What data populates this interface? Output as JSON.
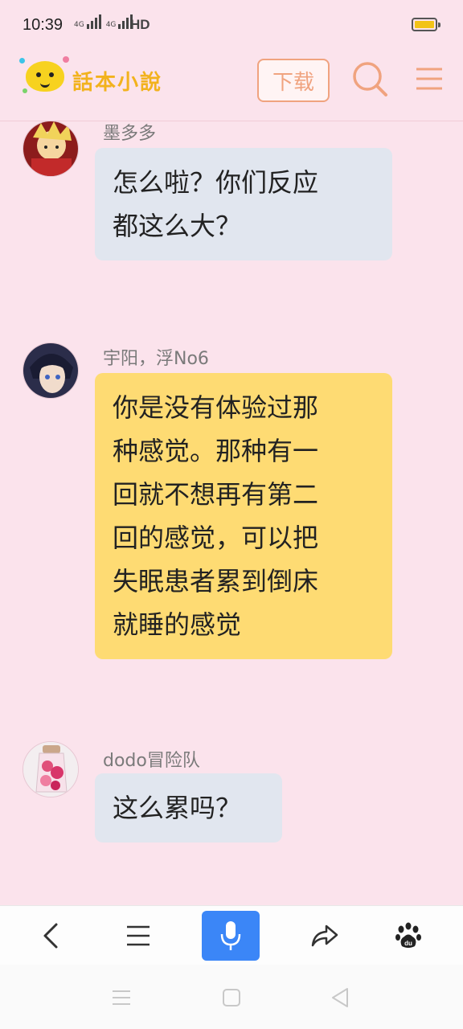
{
  "status_bar": {
    "time": "10:39",
    "network_1": "4G",
    "network_2": "4G",
    "hd": "HD",
    "battery_level": 0.9
  },
  "header": {
    "logo_text": "話本小說",
    "download_label": "下载",
    "search_icon": "search-icon",
    "menu_icon": "menu-icon"
  },
  "messages": [
    {
      "name": "墨多多",
      "text_lines": [
        "怎么啦？你们反应",
        "都这么大？"
      ],
      "style": "gray"
    },
    {
      "name": "宇阳，浮No6",
      "text_lines": [
        "你是没有体验过那",
        "种感觉。那种有一",
        "回就不想再有第二",
        "回的感觉，可以把",
        "失眠患者累到倒床",
        "就睡的感觉"
      ],
      "style": "yellow"
    },
    {
      "name": "dodo冒险队",
      "text_lines": [
        "这么累吗？"
      ],
      "style": "gray"
    }
  ],
  "toolbar": {
    "items": [
      "back-icon",
      "menu-lines-icon",
      "microphone-icon",
      "share-icon",
      "baidu-paw-icon"
    ],
    "accent": "#3b86f7"
  },
  "navbar": {
    "items": [
      "recent-apps-icon",
      "home-icon",
      "back-triangle-icon"
    ]
  },
  "colors": {
    "background": "#fbe3ec",
    "bubble_gray": "#e1e6ef",
    "bubble_yellow": "#fedb73",
    "brand_orange": "#f0a37f",
    "logo_yellow": "#f2b21d"
  }
}
